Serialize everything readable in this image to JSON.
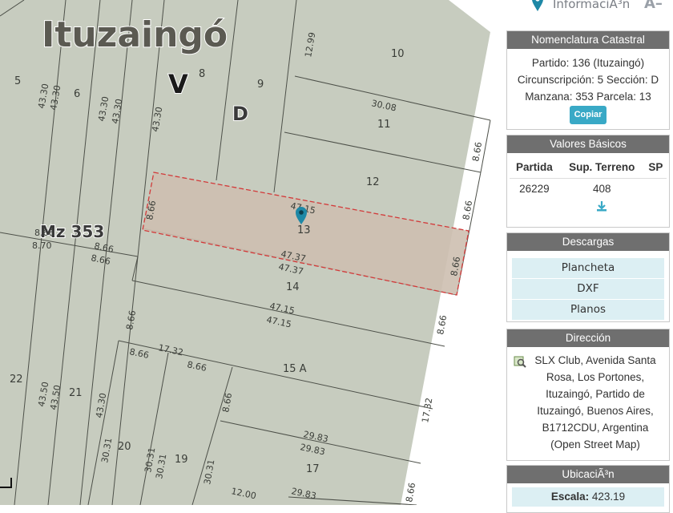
{
  "map": {
    "locality_label": "Ituzaingó",
    "circ_label": "V",
    "section_label": "D",
    "block_label": "Mz 353",
    "plot_labels": [
      "5",
      "6",
      "8",
      "9",
      "10",
      "11",
      "12",
      "13",
      "14",
      "15 A",
      "17",
      "19",
      "20",
      "21",
      "22"
    ],
    "measurements": [
      "12.99",
      "43.30",
      "43.30",
      "43.30",
      "43.30",
      "43.30",
      "30.08",
      "8.66",
      "8.66",
      "8.66",
      "47.15",
      "47.37",
      "47.37",
      "8.66",
      "8.66",
      "8.70",
      "8.66",
      "8.66",
      "47.15",
      "47.15",
      "8.66",
      "8.66",
      "17.32",
      "8.66",
      "8.66",
      "17.32",
      "43.50",
      "43.50",
      "43.30",
      "30.31",
      "30.31",
      "30.31",
      "30.31",
      "8.66",
      "29.83",
      "29.83",
      "12.00",
      "29.83",
      "8.66"
    ]
  },
  "panel": {
    "top_title": "InformaciÃ³n",
    "top_icon": "pin-icon",
    "nomenclatura": {
      "header": "Nomenclatura Catastral",
      "line1": "Partido: 136 (Ituzaingó)",
      "line2": "Circunscripción: 5 Sección: D",
      "line3": "Manzana: 353 Parcela: 13",
      "copy_label": "Copiar"
    },
    "valores": {
      "header": "Valores Básicos",
      "col1": "Partida",
      "col2": "Sup. Terreno",
      "col3": "SP",
      "partida": "26229",
      "sup": "408",
      "sp": ""
    },
    "descargas": {
      "header": "Descargas",
      "items": [
        "Plancheta",
        "DXF",
        "Planos"
      ]
    },
    "direccion": {
      "header": "Dirección",
      "text": "SLX Club, Avenida Santa Rosa, Los Portones, Ituzaingó, Partido de Ituzaingó, Buenos Aires, B1712CDU, Argentina (Open Street Map)"
    },
    "ubicacion": {
      "header": "UbicaciÃ³n",
      "scale_label": "Escala:",
      "scale_value": "423.19"
    }
  },
  "colors": {
    "map_bg": "#c7ccbf",
    "highlight_fill": "#cdbfb0",
    "highlight_stroke": "#d23a3a",
    "accent": "#39a9c6"
  }
}
